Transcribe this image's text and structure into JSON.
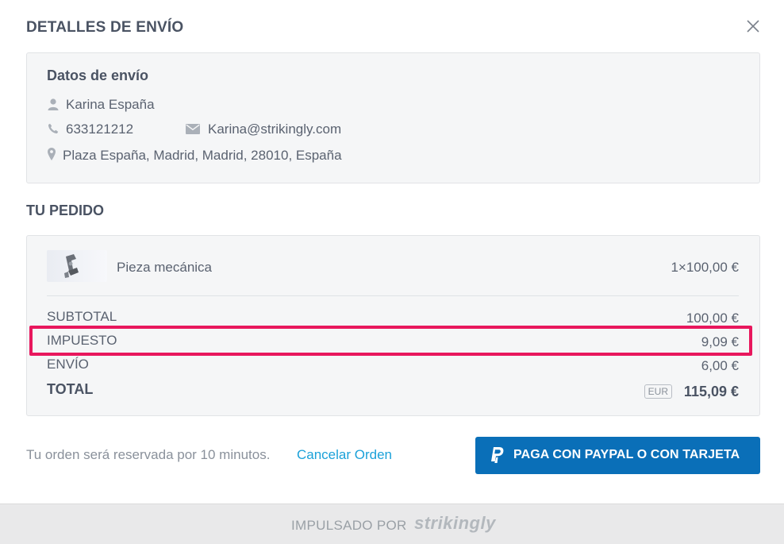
{
  "modal": {
    "title": "DETALLES DE ENVÍO",
    "close_icon": "close-icon"
  },
  "shipping": {
    "heading": "Datos de envío",
    "name": "Karina España",
    "phone": "633121212",
    "email": "Karina@strikingly.com",
    "address": "Plaza España, Madrid, Madrid, 28010, España",
    "icons": [
      "user-icon",
      "phone-icon",
      "envelope-icon",
      "map-pin-icon"
    ]
  },
  "order": {
    "section_title": "TU PEDIDO",
    "item": {
      "name": "Pieza mecánica",
      "price": "1×100,00 €"
    },
    "subtotal_label": "SUBTOTAL",
    "subtotal_value": "100,00 €",
    "tax_label": "IMPUESTO",
    "tax_value": "9,09 €",
    "shipping_label": "ENVÍO",
    "shipping_value": "6,00 €",
    "total_label": "TOTAL",
    "currency": "EUR",
    "total_value": "115,09 €"
  },
  "actions": {
    "reserve_note": "Tu orden será reservada por 10 minutos.",
    "cancel_label": "Cancelar Orden",
    "pay_label": "PAGA CON PAYPAL O CON TARJETA",
    "pay_icon": "paypal-icon"
  },
  "footer": {
    "powered_by": "IMPULSADO POR",
    "brand": "strikingly"
  },
  "colors": {
    "accent": "#0a6fb8",
    "link": "#1ba1d9",
    "highlight": "#e8175d",
    "panel_bg": "#f5f6f7"
  }
}
